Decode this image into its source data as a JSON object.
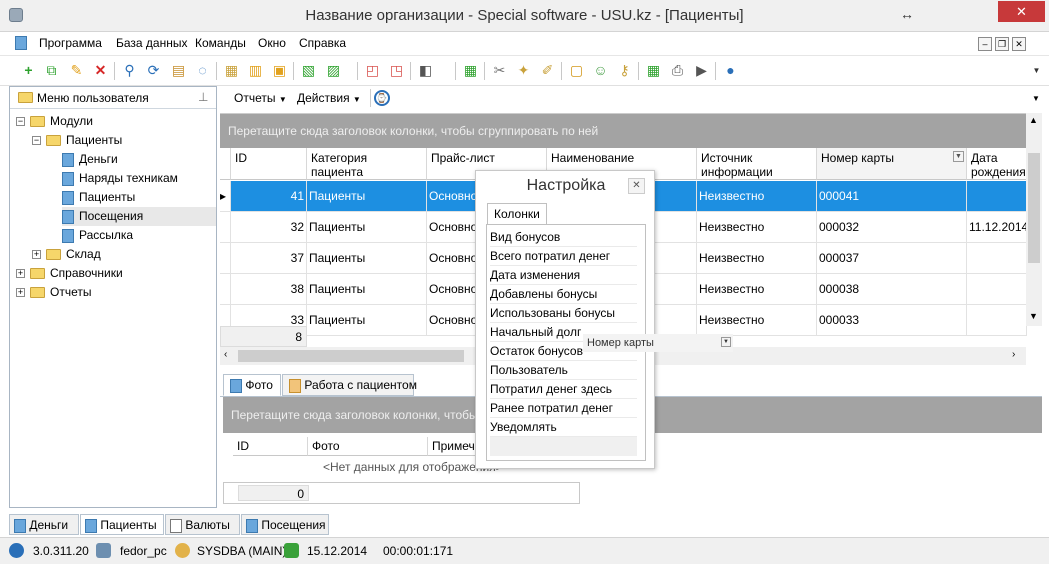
{
  "window": {
    "title": "Название организации - Special software - USU.kz - [Пациенты]",
    "close": "✕",
    "resize": "↔"
  },
  "menu": {
    "items": [
      "Программа",
      "База данных",
      "Команды",
      "Окно",
      "Справка"
    ],
    "mdi_min": "–",
    "mdi_restore": "❐",
    "mdi_close": "✕"
  },
  "sidebar": {
    "header": "Меню пользователя",
    "tree": [
      {
        "label": "Модули",
        "level": 0,
        "type": "folder",
        "expanded": true
      },
      {
        "label": "Пациенты",
        "level": 1,
        "type": "folder",
        "expanded": true
      },
      {
        "label": "Деньги",
        "level": 2,
        "type": "doc"
      },
      {
        "label": "Наряды техникам",
        "level": 2,
        "type": "doc"
      },
      {
        "label": "Пациенты",
        "level": 2,
        "type": "doc"
      },
      {
        "label": "Посещения",
        "level": 2,
        "type": "doc",
        "selected": true
      },
      {
        "label": "Рассылка",
        "level": 2,
        "type": "doc"
      },
      {
        "label": "Склад",
        "level": 1,
        "type": "folder",
        "expanded": false
      },
      {
        "label": "Справочники",
        "level": 0,
        "type": "folder",
        "expanded": false
      },
      {
        "label": "Отчеты",
        "level": 0,
        "type": "folder",
        "expanded": false
      }
    ]
  },
  "main_toolbar": {
    "reports": "Отчеты",
    "actions": "Действия"
  },
  "grid": {
    "group_hint": "Перетащите сюда заголовок колонки, чтобы сгруппировать по ней",
    "columns": [
      "ID",
      "Категория пациента",
      "Прайс-лист",
      "Наименование",
      "Источник информации",
      "Номер карты",
      "Дата рождения"
    ],
    "rows": [
      {
        "id": "41",
        "category": "Пациенты",
        "price": "Основной",
        "name": "",
        "source": "Неизвестно",
        "card": "000041",
        "dob": "",
        "selected": true
      },
      {
        "id": "32",
        "category": "Пациенты",
        "price": "Основной",
        "name": "",
        "source": "Неизвестно",
        "card": "000032",
        "dob": "11.12.2014"
      },
      {
        "id": "37",
        "category": "Пациенты",
        "price": "Основной",
        "name": "",
        "source": "Неизвестно",
        "card": "000037",
        "dob": ""
      },
      {
        "id": "38",
        "category": "Пациенты",
        "price": "Основной",
        "name": "",
        "source": "Неизвестно",
        "card": "000038",
        "dob": ""
      },
      {
        "id": "33",
        "category": "Пациенты",
        "price": "Основной",
        "name": "",
        "source": "Неизвестно",
        "card": "000033",
        "dob": ""
      }
    ],
    "footer_count": "8"
  },
  "customize": {
    "title": "Настройка",
    "tab": "Колонки",
    "items": [
      "Вид бонусов",
      "Всего потратил денег",
      "Дата изменения",
      "Добавлены бонусы",
      "Использованы бонусы",
      "Начальный долг",
      "Остаток бонусов",
      "Пользователь",
      "Потратил денег здесь",
      "Ранее потратил денег",
      "Уведомлять"
    ],
    "drag_column": "Номер карты"
  },
  "detail_tabs": [
    "Фото",
    "Работа с пациентом"
  ],
  "detail_grid": {
    "group_hint": "Перетащите сюда заголовок колонки, чтобы сгруппировать по ней",
    "columns": [
      "ID",
      "Фото",
      "Примечание"
    ],
    "empty": "<Нет данных для отображения>",
    "footer_count": "0"
  },
  "window_tabs": [
    "Деньги",
    "Пациенты",
    "Валюты",
    "Посещения"
  ],
  "status": {
    "version": "3.0.311.20",
    "computer": "fedor_pc",
    "user": "SYSDBA (MAIN)",
    "date": "15.12.2014",
    "timer": "00:00:01:171"
  }
}
